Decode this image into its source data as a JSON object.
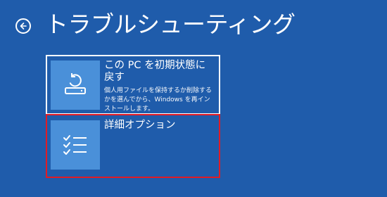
{
  "header": {
    "back_icon": "back-arrow-circle-icon",
    "title": "トラブルシューティング"
  },
  "options": [
    {
      "icon": "reset-pc-icon",
      "title": "この PC を初期状態に戻す",
      "description": "個人用ファイルを保持するか削除するかを選んでから、Windows を再インストールします。"
    },
    {
      "icon": "checklist-icon",
      "title": "詳細オプション",
      "description": ""
    }
  ],
  "colors": {
    "background": "#1f5cab",
    "tile_icon_background": "#4a90d9",
    "selected_tile_border": "#e11b25",
    "tile_border": "#ffffff",
    "text": "#ffffff"
  }
}
